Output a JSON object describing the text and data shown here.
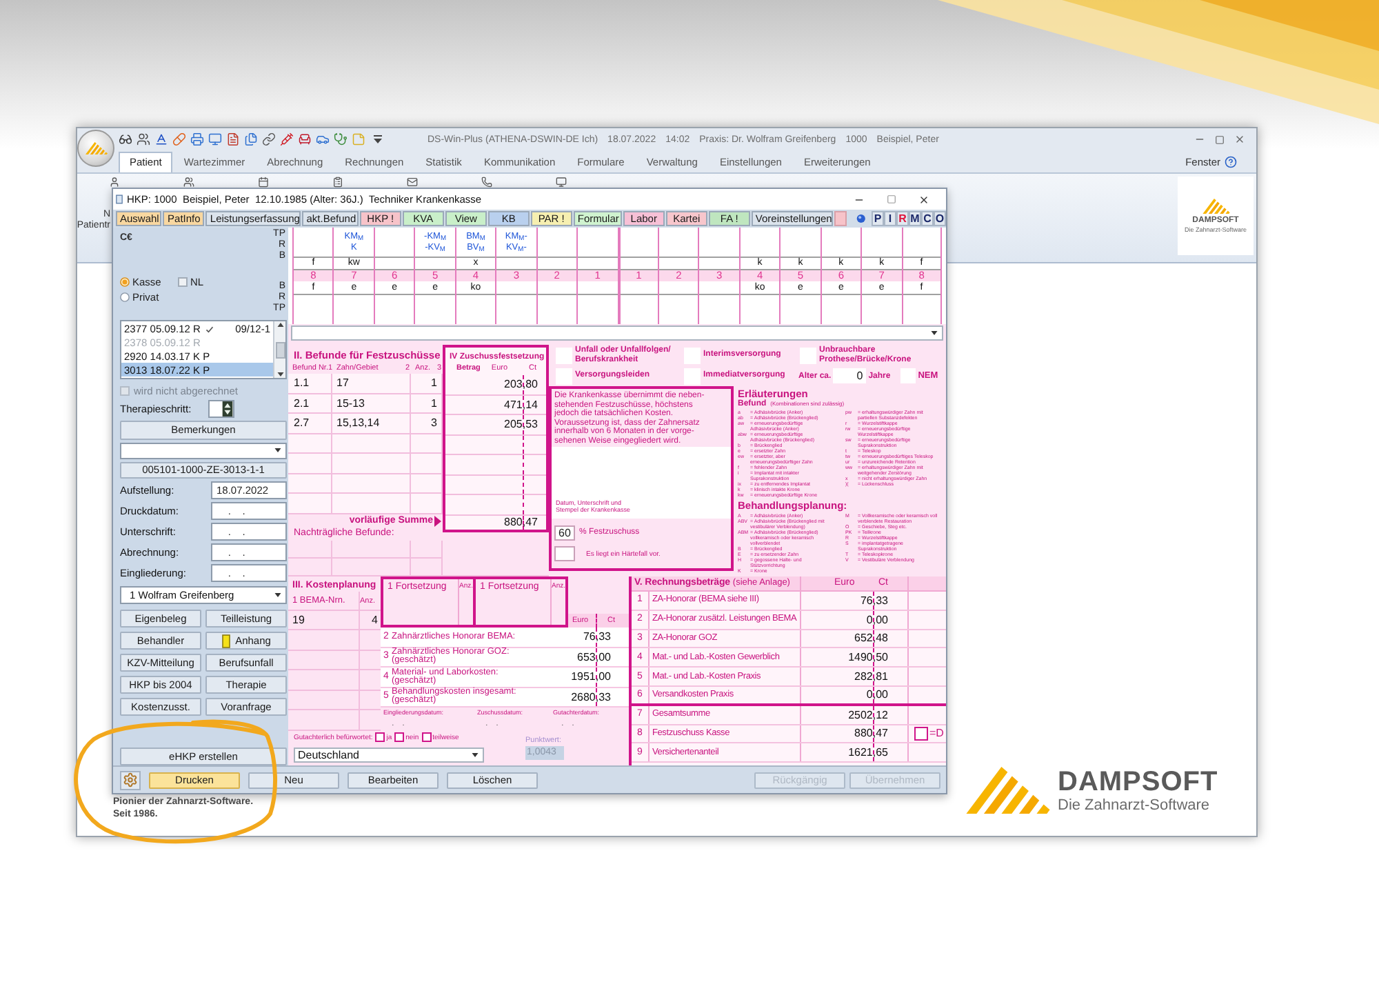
{
  "app": {
    "title_parts": [
      "DS-Win-Plus (ATHENA-DSWIN-DE Ich)",
      "18.07.2022",
      "14:02",
      "Praxis: Dr. Wolfram Greifenberg",
      "1000",
      "Beispiel, Peter"
    ],
    "tabs": [
      {
        "label": "Patient",
        "selected": true
      },
      {
        "label": "Wartezimmer",
        "selected": false
      },
      {
        "label": "Abrechnung",
        "selected": false
      },
      {
        "label": "Rechnungen",
        "selected": false
      },
      {
        "label": "Statistik",
        "selected": false
      },
      {
        "label": "Kommunikation",
        "selected": false
      },
      {
        "label": "Formulare",
        "selected": false
      },
      {
        "label": "Verwaltung",
        "selected": false
      },
      {
        "label": "Einstellungen",
        "selected": false
      },
      {
        "label": "Erweiterungen",
        "selected": false
      }
    ],
    "window_menu": "Fenster",
    "ribbon_labels": [
      "N",
      "Patientr"
    ],
    "logo": {
      "name": "DAMPSOFT",
      "tagline": "Die Zahnarzt-Software"
    }
  },
  "dialog": {
    "title": "HKP: 1000  Beispiel, Peter  12.10.1985 (Alter: 36J.)  Techniker Krankenkasse",
    "tabs": [
      {
        "label": "Auswahl",
        "color": "#f8d7a0"
      },
      {
        "label": "PatInfo",
        "color": "#f8d7a0"
      },
      {
        "label": "Leistungserfassung",
        "color": "#dbe3ec"
      },
      {
        "label": "akt.Befund",
        "color": "#dbe3ec"
      },
      {
        "label": "HKP !",
        "color": "#f7c3c9"
      },
      {
        "label": "KVA",
        "color": "#c9efc9"
      },
      {
        "label": "View",
        "color": "#c9efc9"
      },
      {
        "label": "KB",
        "color": "#b9d0ee"
      },
      {
        "label": "PAR !",
        "color": "#f6efb0"
      },
      {
        "label": "Formular",
        "color": "#cff3cf"
      },
      {
        "label": "Labor",
        "color": "#f7c0d6"
      },
      {
        "label": "Kartei",
        "color": "#f7c6cc"
      },
      {
        "label": "FA !",
        "color": "#bfe6bf"
      },
      {
        "label": "Voreinstellungen",
        "color": "#dbe3ec"
      }
    ],
    "letters": [
      {
        "label": "P",
        "color": "#1d2a6b"
      },
      {
        "label": "I",
        "color": "#1d2a6b"
      },
      {
        "label": "R",
        "color": "#e0143c"
      },
      {
        "label": "M",
        "color": "#1d2a6b"
      },
      {
        "label": "C",
        "color": "#1d2a6b"
      },
      {
        "label": "O",
        "color": "#1d2a6b"
      }
    ]
  },
  "left_panel": {
    "ce_mark": "C€",
    "labels_upper": [
      "TP",
      "R",
      "B"
    ],
    "labels_lower": [
      "B",
      "R",
      "TP"
    ],
    "insurance": [
      {
        "label": "Kasse",
        "selected": true
      },
      {
        "label": "Privat",
        "selected": false
      }
    ],
    "nl": {
      "label": "NL",
      "checked": false
    },
    "plans": [
      {
        "label": "2377 05.09.12 R",
        "checked": true,
        "period": "09/12-1",
        "disabled": false,
        "selected": false
      },
      {
        "label": "2378 05.09.12 R",
        "checked": false,
        "disabled": true,
        "selected": false
      },
      {
        "label": "2920 14.03.17 K P",
        "checked": false,
        "disabled": false,
        "selected": false
      },
      {
        "label": "3013 18.07.22 K P",
        "checked": false,
        "disabled": false,
        "selected": true
      }
    ],
    "not_billed": {
      "label": "wird nicht abgerechnet",
      "checked": false,
      "disabled": true
    },
    "therapy_step": "Therapieschritt:",
    "remarks": "Bemerkungen",
    "plan_id": "005101-1000-ZE-3013-1-1",
    "dates": [
      {
        "label": "Aufstellung:",
        "value": "18.07.2022"
      },
      {
        "label": "Druckdatum:",
        "value": "    .    ."
      },
      {
        "label": "Unterschrift:",
        "value": "    .    ."
      },
      {
        "label": "Abrechnung:",
        "value": "    .    ."
      },
      {
        "label": "Eingliederung:",
        "value": "    .    ."
      }
    ],
    "dentist": "1 Wolfram Greifenberg",
    "buttons": [
      {
        "label": "Eigenbeleg",
        "kind": "plain"
      },
      {
        "label": "Teilleistung",
        "kind": "plain"
      },
      {
        "label": "Behandler",
        "kind": "plain"
      },
      {
        "label": "Anhang",
        "kind": "attachment"
      },
      {
        "label": "KZV-Mitteilung",
        "kind": "plain"
      },
      {
        "label": "Berufsunfall",
        "kind": "plain"
      },
      {
        "label": "HKP bis 2004",
        "kind": "plain"
      },
      {
        "label": "Therapie",
        "kind": "plain"
      },
      {
        "label": "Kostenzusst.",
        "kind": "plain"
      },
      {
        "label": "Voranfrage",
        "kind": "plain"
      }
    ],
    "ehkp": "eHKP erstellen"
  },
  "tooth_chart": {
    "teeth": [
      {
        "number": "8",
        "r": "f",
        "b": "f"
      },
      {
        "number": "7",
        "tp": [
          "KM$_{M}$",
          "K"
        ],
        "r": "kw",
        "b": "e"
      },
      {
        "number": "6",
        "b": "e"
      },
      {
        "number": "5",
        "tp": [
          "-KM$_{M}$",
          "-KV$_{M}$"
        ],
        "b": "e"
      },
      {
        "number": "4",
        "tp": [
          "BM$_{M}$",
          "BV$_{M}$"
        ],
        "r": "x",
        "b": "ko"
      },
      {
        "number": "3",
        "tp": [
          "KM$_{M}$-",
          "KV$_{M}$-"
        ]
      },
      {
        "number": "2"
      },
      {
        "number": "1"
      },
      {
        "number": "1"
      },
      {
        "number": "2"
      },
      {
        "number": "3"
      },
      {
        "number": "4",
        "r": "k",
        "b": "ko"
      },
      {
        "number": "5",
        "r": "k",
        "b": "e"
      },
      {
        "number": "6",
        "r": "k",
        "b": "e"
      },
      {
        "number": "7",
        "r": "k",
        "b": "e"
      },
      {
        "number": "8",
        "r": "f",
        "b": "f"
      }
    ]
  },
  "findings": {
    "title": "II. Befunde für Festzuschüsse",
    "columns": [
      {
        "label": "Befund Nr.",
        "number": "1"
      },
      {
        "label": "Zahn/Gebiet",
        "number": "2"
      },
      {
        "label": "Anz.",
        "number": "3"
      }
    ],
    "rows": [
      {
        "finding": "1.1",
        "area": "17",
        "count": "1",
        "amount": "203,80"
      },
      {
        "finding": "2.1",
        "area": "15-13",
        "count": "1",
        "amount": "471,14"
      },
      {
        "finding": "2.7",
        "area": "15,13,14",
        "count": "3",
        "amount": "205,53"
      }
    ],
    "subtotal_label": "vorläufige Summe",
    "subtotal": "880,47",
    "later_label": "Nachträgliche Befunde:"
  },
  "subsidy": {
    "title": "IV Zuschussfestsetzung",
    "columns": [
      "Betrag",
      "Euro",
      "Ct"
    ]
  },
  "flags": [
    {
      "label": "Unfall oder Unfallfolgen/ Berufskrankheit",
      "checked": false
    },
    {
      "label": "Interimsversorgung",
      "checked": false
    },
    {
      "label": "Unbrauchbare Prothese/Brücke/Krone",
      "checked": false
    },
    {
      "label": "Versorgungsleiden",
      "checked": false
    },
    {
      "label": "Immediatversorgung",
      "checked": false
    }
  ],
  "age": {
    "label": "Alter ca.",
    "value": "0",
    "unit": "Jahre"
  },
  "nem": {
    "label": "NEM",
    "checked": false
  },
  "notice": {
    "lines": [
      "Die Krankenkasse übernimmt die neben-",
      "stehenden Festzuschüsse, höchstens",
      "jedoch die tatsächlichen Kosten.",
      "Voraussetzung ist, dass der Zahnersatz",
      "innerhalb von 6 Monaten in der vorge-",
      "sehenen Weise eingegliedert wird."
    ],
    "stamp_label": "Datum, Unterschrift und Stempel der Krankenkasse",
    "percent": {
      "value": "60",
      "label": "% Festzuschuss"
    },
    "hardship": {
      "label": "Es liegt ein Härtefall vor.",
      "checked": false
    }
  },
  "legend": {
    "title": "Erläuterungen",
    "findings_title": "Befund",
    "findings_note": "(Kombinationen sind zulässig)",
    "findings_left": [
      {
        "code": "a",
        "text": "= Adhäsivbrücke (Anker)"
      },
      {
        "code": "ab",
        "text": "= Adhäsivbrücke (Brückenglied)"
      },
      {
        "code": "aw",
        "text": "= erneuerungsbedürftige Adhäsivbrücke (Anker)"
      },
      {
        "code": "abw",
        "text": "= erneuerungsbedürftige Adhäsivbrücke (Brückenglied)"
      },
      {
        "code": "b",
        "text": "= Brückenglied"
      },
      {
        "code": "e",
        "text": "= ersetzter Zahn"
      },
      {
        "code": "ew",
        "text": "= ersetzter, aber erneuerungsbedürftiger Zahn"
      },
      {
        "code": "f",
        "text": "= fehlender Zahn"
      },
      {
        "code": "i",
        "text": "= Implantat mit intakter Suprakonstruktion"
      },
      {
        "code": "ix",
        "text": "= zu entfernendes Implantat"
      },
      {
        "code": "k",
        "text": "= klinisch intakte Krone"
      },
      {
        "code": "kw",
        "text": "= erneuerungsbedürftige Krone"
      }
    ],
    "findings_right": [
      {
        "code": "pw",
        "text": "= erhaltungswürdiger Zahn mit partiellen Substanzdefekten"
      },
      {
        "code": "r",
        "text": "= Wurzelstiftkappe"
      },
      {
        "code": "rw",
        "text": "= erneuerungsbedürftige Wurzelstiftkappe"
      },
      {
        "code": "sw",
        "text": "= erneuerungsbedürftige Suprakonstruktion"
      },
      {
        "code": "t",
        "text": "= Teleskop"
      },
      {
        "code": "tw",
        "text": "= erneuerungsbedürftiges Teleskop"
      },
      {
        "code": "ur",
        "text": "= unzureichende Retention"
      },
      {
        "code": "ww",
        "text": "= erhaltungswürdiger Zahn mit weitgehender Zerstörung"
      },
      {
        "code": "x",
        "text": "= nicht erhaltungswürdiger Zahn"
      },
      {
        "code": ")(",
        "text": "= Lückenschluss"
      }
    ],
    "planning_title": "Behandlungsplanung:",
    "planning_left": [
      {
        "code": "A",
        "text": "= Adhäsivbrücke (Anker)"
      },
      {
        "code": "ABV",
        "text": "= Adhäsivbrücke (Brückenglied mit vestibulärer Verblendung)"
      },
      {
        "code": "ABM",
        "text": "= Adhäsivbrücke (Brückenglied) vollkeramisch oder keramisch vollverblendet"
      },
      {
        "code": "B",
        "text": "= Brückenglied"
      },
      {
        "code": "E",
        "text": "= zu ersetzender Zahn"
      },
      {
        "code": "H",
        "text": "= gegossene Halte- und Stützvorrichtung"
      },
      {
        "code": "K",
        "text": "= Krone"
      }
    ],
    "planning_right": [
      {
        "code": "M",
        "text": "= Vollkeramische oder keramisch voll verblendete Restauration"
      },
      {
        "code": "O",
        "text": "= Geschiebe, Steg etc."
      },
      {
        "code": "PK",
        "text": "= Teilkrone"
      },
      {
        "code": "R",
        "text": "= Wurzelstiftkappe"
      },
      {
        "code": "S",
        "text": "= implantatgetragene Suprakonstruktion"
      },
      {
        "code": "T",
        "text": "= Teleskopkrone"
      },
      {
        "code": "V",
        "text": "= Vestibuläre Verblendung"
      }
    ]
  },
  "cost_plan": {
    "title": "III. Kostenplanung",
    "columns": [
      "1 BEMA-Nrn.",
      "Anz."
    ],
    "rows": [
      {
        "code": "19",
        "count": "4"
      }
    ],
    "continuations": [
      {
        "label": "1 Fortsetzung",
        "count_label": "Anz."
      },
      {
        "label": "1 Fortsetzung",
        "count_label": "Anz."
      }
    ],
    "amount_columns": [
      "Euro",
      "Ct"
    ],
    "costs": [
      {
        "number": "2",
        "label": "Zahnärztliches Honorar BEMA:",
        "amount": "76,33"
      },
      {
        "number": "3",
        "label": "Zahnärztliches Honorar GOZ:",
        "note": "(geschätzt)",
        "amount": "653,00"
      },
      {
        "number": "4",
        "label": "Material- und Laborkosten:",
        "note": "(geschätzt)",
        "amount": "1951,00"
      },
      {
        "number": "5",
        "label": "Behandlungskosten insgesamt:",
        "note": "(geschätzt)",
        "amount": "2680,33"
      }
    ],
    "dates": [
      {
        "label": "Eingliederungsdatum:",
        "value": "    .    ."
      },
      {
        "label": "Zuschussdatum:",
        "value": "    .    ."
      },
      {
        "label": "Gutachterdatum:",
        "value": "    .    ."
      }
    ],
    "review": {
      "label": "Gutachterlich befürwortet:",
      "options": [
        {
          "label": "ja",
          "checked": false
        },
        {
          "label": "nein",
          "checked": false
        },
        {
          "label": "teilweise",
          "checked": false
        }
      ]
    },
    "country": "Deutschland",
    "point_value": {
      "label": "Punktwert:",
      "value": "1,0043",
      "disabled": true
    }
  },
  "invoice": {
    "title": "V. Rechnungsbeträge",
    "note": "(siehe Anlage)",
    "columns": [
      "Euro",
      "Ct"
    ],
    "rows": [
      {
        "number": "1",
        "label": "ZA-Honorar (BEMA siehe III)",
        "amount": "76,33"
      },
      {
        "number": "2",
        "label": "ZA-Honorar zusätzl. Leistungen BEMA",
        "amount": "0,00"
      },
      {
        "number": "3",
        "label": "ZA-Honorar GOZ",
        "amount": "652,48"
      },
      {
        "number": "4",
        "label": "Mat.- und Lab.-Kosten Gewerblich",
        "amount": "1490,50"
      },
      {
        "number": "5",
        "label": "Mat.- und Lab.-Kosten Praxis",
        "amount": "282,81"
      },
      {
        "number": "6",
        "label": "Versandkosten Praxis",
        "amount": "0,00"
      }
    ],
    "totals": [
      {
        "number": "7",
        "label": "Gesamtsumme",
        "amount": "2502,12"
      },
      {
        "number": "8",
        "label": "Festzuschuss Kasse",
        "amount": "880,47",
        "flag": {
          "label": "=D",
          "checked": false
        }
      },
      {
        "number": "9",
        "label": "Versichertenanteil",
        "amount": "1621,65"
      }
    ]
  },
  "actions_left": [
    {
      "label": "Drucken",
      "highlighted": true,
      "disabled": false
    },
    {
      "label": "Neu",
      "highlighted": false,
      "disabled": false
    },
    {
      "label": "Bearbeiten",
      "highlighted": false,
      "disabled": false
    },
    {
      "label": "Löschen",
      "highlighted": false,
      "disabled": false
    }
  ],
  "actions_right": [
    {
      "label": "Rückgängig",
      "highlighted": false,
      "disabled": true
    },
    {
      "label": "Übernehmen",
      "highlighted": false,
      "disabled": true
    }
  ],
  "tagline": [
    "Pionier der Zahnarzt-Software.",
    "Seit 1986."
  ],
  "brand": {
    "name": "DAMPSOFT",
    "tagline": "Die Zahnarzt-Software"
  }
}
